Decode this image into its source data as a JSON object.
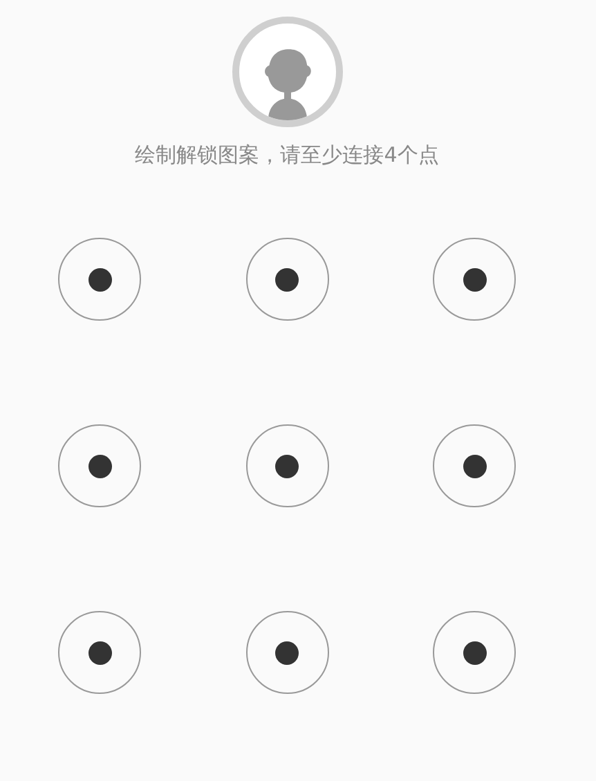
{
  "hint": "绘制解锁图案，请至少连接4个点",
  "nodes": [
    {
      "selected": false
    },
    {
      "selected": false
    },
    {
      "selected": false
    },
    {
      "selected": false
    },
    {
      "selected": false
    },
    {
      "selected": false
    },
    {
      "selected": false
    },
    {
      "selected": false
    },
    {
      "selected": false
    }
  ]
}
